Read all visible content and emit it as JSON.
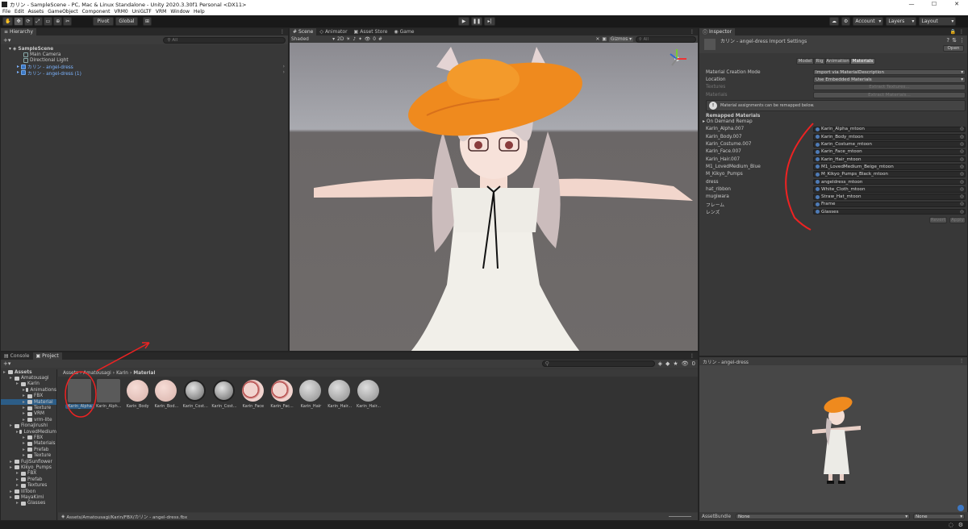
{
  "window": {
    "title": "カリン - SampleScene - PC, Mac & Linux Standalone - Unity 2020.3.30f1 Personal <DX11>",
    "min": "—",
    "max": "☐",
    "close": "✕"
  },
  "menu": [
    "File",
    "Edit",
    "Assets",
    "GameObject",
    "Component",
    "VRM0",
    "UniGLTF",
    "VRM",
    "Window",
    "Help"
  ],
  "toolbar": {
    "pivot": "Pivot",
    "global": "Global",
    "account": "Account",
    "layers": "Layers",
    "layout": "Layout"
  },
  "hierarchy": {
    "tab": "Hierarchy",
    "search_placeholder": "All",
    "scene": "SampleScene",
    "items": [
      {
        "label": "Main Camera",
        "type": "object",
        "indent": 2
      },
      {
        "label": "Directional Light",
        "type": "object",
        "indent": 2
      },
      {
        "label": "カリン - angel-dress",
        "type": "prefab",
        "indent": 1
      },
      {
        "label": "カリン - angel-dress (1)",
        "type": "prefab",
        "indent": 1
      }
    ]
  },
  "scene": {
    "tabs": [
      "Scene",
      "Animator",
      "Asset Store",
      "Game"
    ],
    "shading": "Shaded",
    "mode2d": "2D",
    "gizmos": "Gizmos",
    "search_placeholder": "All",
    "layer_count": "0"
  },
  "inspector": {
    "tab": "Inspector",
    "title": "カリン - angel-dress Import Settings",
    "open": "Open",
    "tabs": [
      "Model",
      "Rig",
      "Animation",
      "Materials"
    ],
    "active_tab": "Materials",
    "fields": [
      {
        "label": "Material Creation Mode",
        "value": "Import via MaterialDescription"
      },
      {
        "label": "Location",
        "value": "Use Embedded Materials"
      }
    ],
    "textures_label": "Textures",
    "materials_label": "Materials",
    "extract_textures": "Extract Textures...",
    "extract_materials": "Extract Materials...",
    "info": "Material assignments can be remapped below.",
    "remapped_header": "Remapped Materials",
    "on_demand": "On Demand Remap",
    "remaps": [
      {
        "name": "Karin_Alpha.007",
        "material": "Karin_Alpha_mtoon"
      },
      {
        "name": "Karin_Body.007",
        "material": "Karin_Body_mtoon"
      },
      {
        "name": "Karin_Costume.007",
        "material": "Karin_Costume_mtoon"
      },
      {
        "name": "Karin_Face.007",
        "material": "Karin_Face_mtoon"
      },
      {
        "name": "Karin_Hair.007",
        "material": "Karin_Hair_mtoon"
      },
      {
        "name": "M1_LovedMedium_Blue",
        "material": "M1_LovedMedium_Beige_mtoon"
      },
      {
        "name": "M_Kikyo_Pumps",
        "material": "M_Kikyo_Pumps_Black_mtoon"
      },
      {
        "name": "dress",
        "material": "angeldress_mtoon"
      },
      {
        "name": "hat_ribbon",
        "material": "White_Cloth_mtoon"
      },
      {
        "name": "mugiwara",
        "material": "Straw_Hat_mtoon"
      },
      {
        "name": "フレーム",
        "material": "Frame"
      },
      {
        "name": "レンズ",
        "material": "Glasses"
      }
    ],
    "revert": "Revert",
    "apply": "Apply",
    "preview_title": "カリン - angel-dress",
    "assetbundle_label": "AssetBundle",
    "assetbundle_value": "None",
    "variant_value": "None"
  },
  "bottom": {
    "tabs": [
      "Console",
      "Project"
    ],
    "breadcrumb": [
      "Assets",
      "Amatousagi",
      "Karin",
      "Material"
    ],
    "status_path": "Assets/Amatousagi/Karin/FBX/カリン - angel-dress.fbx",
    "hidden_count": "0",
    "tree": [
      {
        "label": "Assets",
        "indent": 0,
        "bold": true
      },
      {
        "label": "Amatousagi",
        "indent": 1
      },
      {
        "label": "Karin",
        "indent": 2
      },
      {
        "label": "Animations",
        "indent": 3
      },
      {
        "label": "FBX",
        "indent": 3
      },
      {
        "label": "Material",
        "indent": 3,
        "selected": true
      },
      {
        "label": "Texture",
        "indent": 3
      },
      {
        "label": "VRM",
        "indent": 3
      },
      {
        "label": "vrm-lite",
        "indent": 3
      },
      {
        "label": "FionaJirushi",
        "indent": 1
      },
      {
        "label": "LovedMedium",
        "indent": 2
      },
      {
        "label": "FBX",
        "indent": 3
      },
      {
        "label": "Materials",
        "indent": 3
      },
      {
        "label": "Prefab",
        "indent": 3
      },
      {
        "label": "Texture",
        "indent": 3
      },
      {
        "label": "FujiSunflower",
        "indent": 1
      },
      {
        "label": "Kikyo_Pumps",
        "indent": 1
      },
      {
        "label": "FBX",
        "indent": 2
      },
      {
        "label": "Prefab",
        "indent": 2
      },
      {
        "label": "Textures",
        "indent": 2
      },
      {
        "label": "lilToon",
        "indent": 1
      },
      {
        "label": "MayaKimi",
        "indent": 1
      },
      {
        "label": "Glasses",
        "indent": 2
      }
    ],
    "assets": [
      {
        "label": "Karin_Alpha",
        "style": "flat",
        "selected": true
      },
      {
        "label": "Karin_Alph...",
        "style": "flat"
      },
      {
        "label": "Karin_Body",
        "style": "skin"
      },
      {
        "label": "Karin_Bod...",
        "style": "skin"
      },
      {
        "label": "Karin_Cost...",
        "style": "costume"
      },
      {
        "label": "Karin_Cost...",
        "style": "costume"
      },
      {
        "label": "Karin_Face",
        "style": "face"
      },
      {
        "label": "Karin_Fac...",
        "style": "face"
      },
      {
        "label": "Karin_Hair",
        "style": "hair"
      },
      {
        "label": "Karin_Hair...",
        "style": "hair"
      },
      {
        "label": "Karin_Hair...",
        "style": "hair"
      }
    ]
  }
}
